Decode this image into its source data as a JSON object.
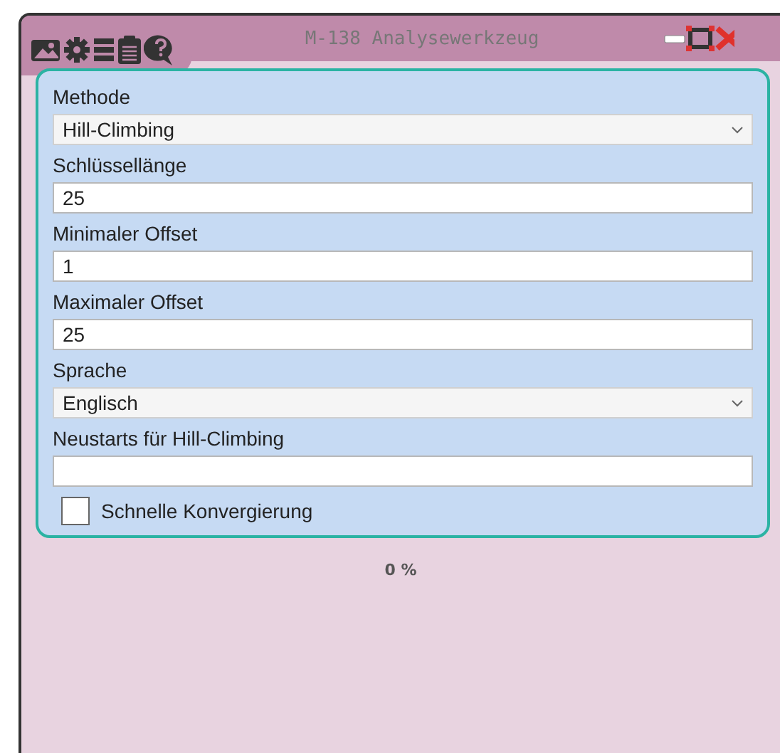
{
  "window": {
    "title": "M-138 Analysewerkzeug"
  },
  "fields": [
    {
      "kind": "select",
      "label": "Methode",
      "value": "Hill-Climbing"
    },
    {
      "kind": "text",
      "label": "Schlüssellänge",
      "value": "25"
    },
    {
      "kind": "text",
      "label": "Minimaler Offset",
      "value": "1"
    },
    {
      "kind": "text",
      "label": "Maximaler Offset",
      "value": "25"
    },
    {
      "kind": "select",
      "label": "Sprache",
      "value": "Englisch"
    },
    {
      "kind": "text",
      "label": "Neustarts für Hill-Climbing"
    },
    {
      "kind": "checkbox",
      "label": "Schnelle Konvergierung",
      "checked": false
    }
  ],
  "status_bar": {
    "progress": "0 %"
  }
}
